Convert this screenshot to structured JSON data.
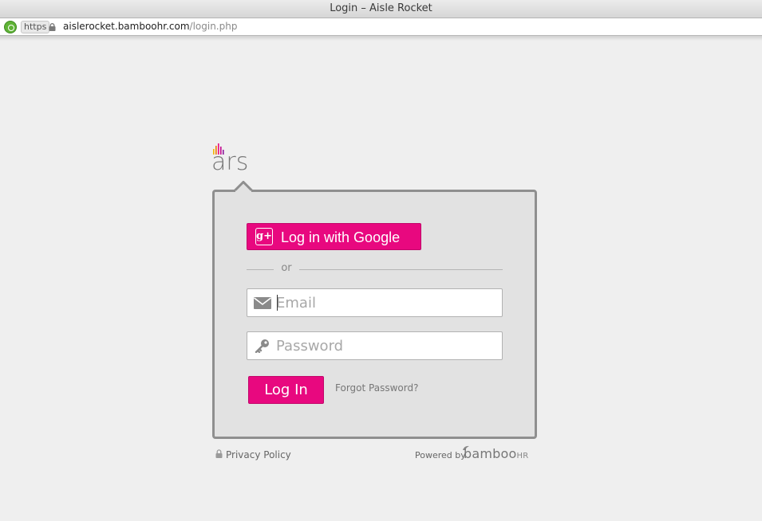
{
  "window": {
    "title": "Login – Aisle Rocket"
  },
  "address_bar": {
    "scheme_badge": "https",
    "host": "aislerocket.bamboohr.com",
    "path": "/login.php"
  },
  "logo": {
    "text": "ars",
    "bar_colors": [
      "#f2b400",
      "#f07a00",
      "#e8087f",
      "#c4068e",
      "#8a1a9c"
    ]
  },
  "login_form": {
    "google_button_label": "Log in with Google",
    "google_icon": "google-plus-icon",
    "divider_text": "or",
    "email": {
      "placeholder": "Email",
      "value": "",
      "icon": "envelope-icon"
    },
    "password": {
      "placeholder": "Password",
      "value": "",
      "icon": "key-icon"
    },
    "login_button_label": "Log In",
    "forgot_password_label": "Forgot Password?"
  },
  "footer": {
    "privacy_label": "Privacy Policy",
    "privacy_icon": "lock-icon",
    "powered_by_label": "Powered by",
    "brand_main": "bamboo",
    "brand_suffix": "HR"
  },
  "colors": {
    "accent": "#e8087f",
    "page_background": "#efefef",
    "card_background": "#e2e2e2",
    "card_border": "#8f8f8f"
  }
}
